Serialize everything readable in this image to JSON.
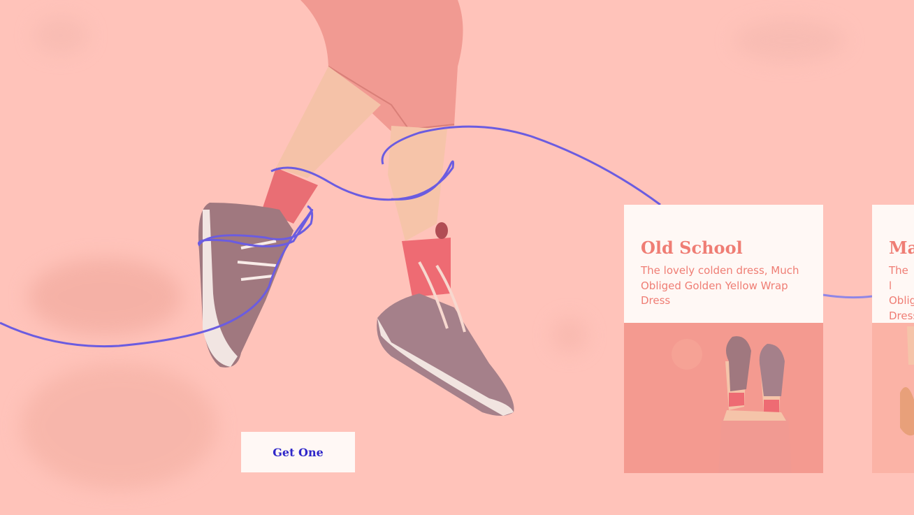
{
  "hero": {
    "cta_label": "Get One"
  },
  "cards": [
    {
      "title": "Old School",
      "description": "The lovely colden dress, Much Obliged Golden Yellow Wrap Dress"
    },
    {
      "title": "Mac",
      "description": "The l Oblig Dress"
    }
  ],
  "colors": {
    "background": "#ffc3ba",
    "accent_text": "#ef7d74",
    "button_text": "#2f27c9",
    "wave_line": "#6b5ce0",
    "card_bg": "#fff8f5"
  }
}
